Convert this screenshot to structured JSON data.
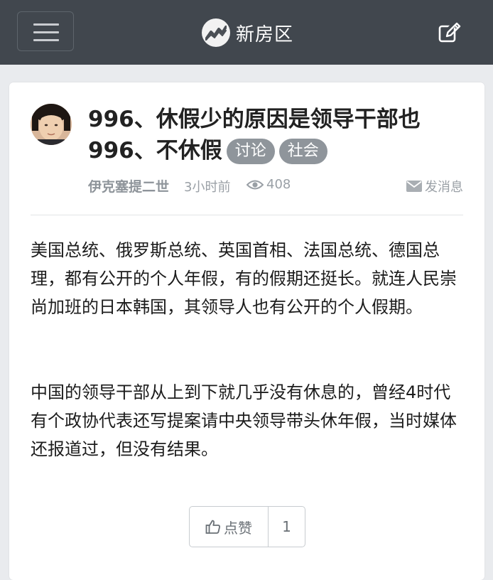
{
  "navbar": {
    "brand": "新房区",
    "menu_icon": "hamburger-menu-icon",
    "logo_icon": "trend-line-logo-icon",
    "edit_icon": "edit-pencil-icon"
  },
  "post": {
    "title_line1": "996、休假少的原因是领导干部也",
    "title_line2": "996、不休假",
    "tags": [
      "讨论",
      "社会"
    ],
    "author": "伊克塞提二世",
    "time": "3小时前",
    "views": "408",
    "message_label": "发消息",
    "paragraphs": [
      "美国总统、俄罗斯总统、英国首相、法国总统、德国总理，都有公开的个人年假，有的假期还挺长。就连人民崇尚加班的日本韩国，其领导人也有公开的个人假期。",
      "中国的领导干部从上到下就几乎没有休息的，曾经4时代有个政协代表还写提案请中央领导带头休年假，当时媒体还报道过，但没有结果。"
    ],
    "like_label": "点赞",
    "like_count": "1"
  },
  "colors": {
    "navbar_bg": "#41474e",
    "page_bg": "#e9ebee",
    "tag_bg": "#8f959b",
    "meta_text": "#9aa0a6"
  }
}
